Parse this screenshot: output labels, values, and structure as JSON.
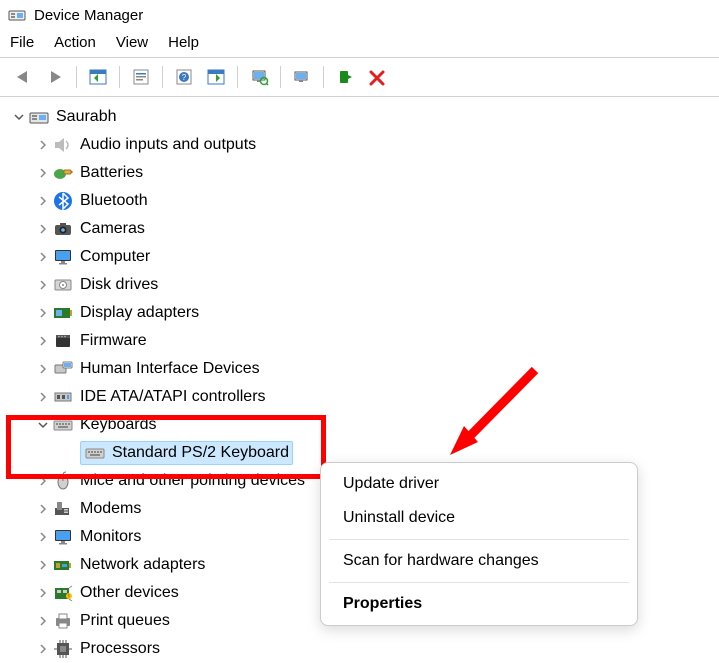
{
  "window": {
    "title": "Device Manager"
  },
  "menu": {
    "file": "File",
    "action": "Action",
    "view": "View",
    "help": "Help"
  },
  "tree": {
    "root": "Saurabh",
    "items": [
      {
        "label": "Audio inputs and outputs"
      },
      {
        "label": "Batteries"
      },
      {
        "label": "Bluetooth"
      },
      {
        "label": "Cameras"
      },
      {
        "label": "Computer"
      },
      {
        "label": "Disk drives"
      },
      {
        "label": "Display adapters"
      },
      {
        "label": "Firmware"
      },
      {
        "label": "Human Interface Devices"
      },
      {
        "label": "IDE ATA/ATAPI controllers"
      },
      {
        "label": "Keyboards"
      },
      {
        "label": "Mice and other pointing devices"
      },
      {
        "label": "Modems"
      },
      {
        "label": "Monitors"
      },
      {
        "label": "Network adapters"
      },
      {
        "label": "Other devices"
      },
      {
        "label": "Print queues"
      },
      {
        "label": "Processors"
      }
    ],
    "keyboards_child": "Standard PS/2 Keyboard"
  },
  "context_menu": {
    "update": "Update driver",
    "uninstall": "Uninstall device",
    "scan": "Scan for hardware changes",
    "properties": "Properties"
  }
}
